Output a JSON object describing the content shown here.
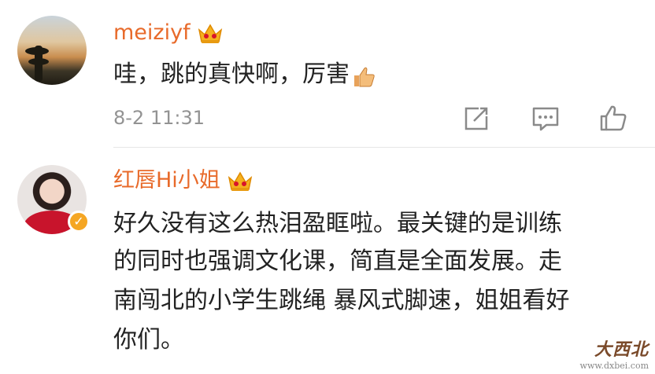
{
  "comments": [
    {
      "username": "meiziyf",
      "text": "哇，跳的真快啊，厉害",
      "timestamp": "8-2 11:31"
    },
    {
      "username": "红唇Hi小姐",
      "text_lines": [
        "好久没有这么热泪盈眶啦。最关键的是训练",
        "的同时也强调文化课，简直是全面发展。走",
        "南闯北的小学生跳绳 暴风式脚速，姐姐看好",
        "你们。"
      ]
    }
  ],
  "watermark": {
    "main": "大西北",
    "url": "www.dxbei.com"
  },
  "colors": {
    "username": "#e86a2a",
    "text": "#222222",
    "timestamp": "#939393",
    "icon": "#8a8a8a",
    "crown": "#f5b21f"
  }
}
